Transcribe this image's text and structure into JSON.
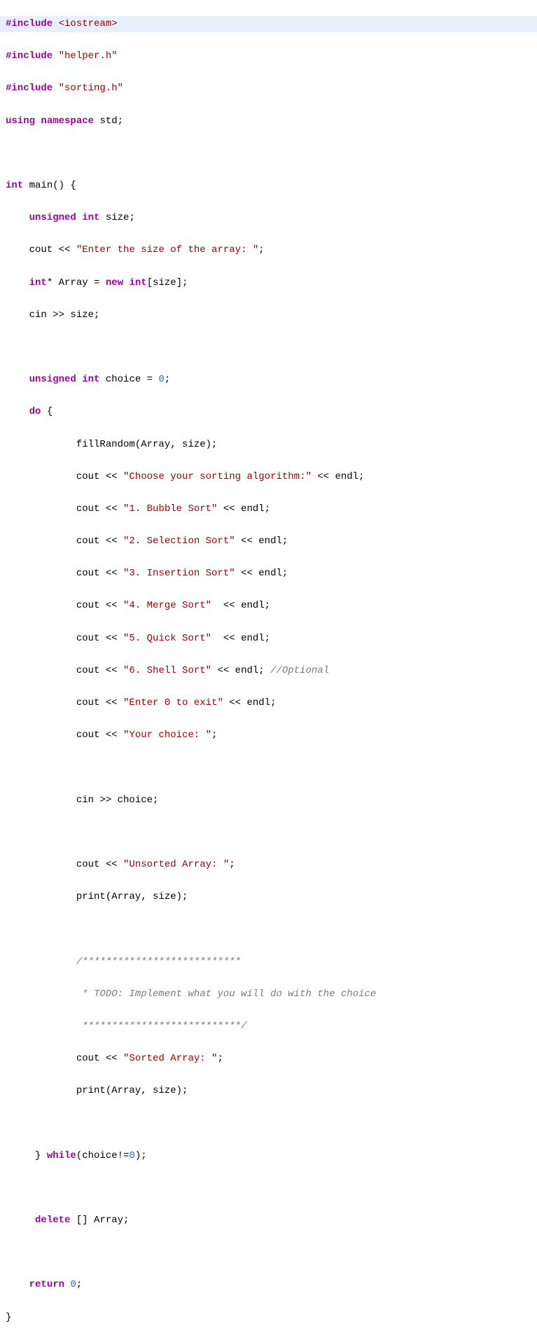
{
  "code": {
    "l1_dir": "#include ",
    "l1_inc": "<iostream>",
    "l2_dir": "#include ",
    "l2_inc": "\"helper.h\"",
    "l3_dir": "#include ",
    "l3_inc": "\"sorting.h\"",
    "l4_a": "using",
    "l4_b": "namespace",
    "l4_c": " std;",
    "l6_a": "int",
    "l6_b": " main() {",
    "l7_a": "    ",
    "l7_b": "unsigned",
    "l7_c": " ",
    "l7_d": "int",
    "l7_e": " size;",
    "l8_a": "    cout << ",
    "l8_b": "\"Enter the size of the array: \"",
    "l8_c": ";",
    "l9_a": "    ",
    "l9_b": "int",
    "l9_c": "* Array = ",
    "l9_d": "new",
    "l9_e": " ",
    "l9_f": "int",
    "l9_g": "[size];",
    "l10": "    cin >> size;",
    "l12_a": "    ",
    "l12_b": "unsigned",
    "l12_c": " ",
    "l12_d": "int",
    "l12_e": " choice = ",
    "l12_f": "0",
    "l12_g": ";",
    "l13_a": "    ",
    "l13_b": "do",
    "l13_c": " {",
    "l14": "            fillRandom(Array, size);",
    "l15_a": "            cout << ",
    "l15_b": "\"Choose your sorting algorithm:\"",
    "l15_c": " << endl;",
    "l16_a": "            cout << ",
    "l16_b": "\"1. Bubble Sort\"",
    "l16_c": " << endl;",
    "l17_a": "            cout << ",
    "l17_b": "\"2. Selection Sort\"",
    "l17_c": " << endl;",
    "l18_a": "            cout << ",
    "l18_b": "\"3. Insertion Sort\"",
    "l18_c": " << endl;",
    "l19_a": "            cout << ",
    "l19_b": "\"4. Merge Sort\"",
    "l19_c": "  << endl;",
    "l20_a": "            cout << ",
    "l20_b": "\"5. Quick Sort\"",
    "l20_c": "  << endl;",
    "l21_a": "            cout << ",
    "l21_b": "\"6. Shell Sort\"",
    "l21_c": " << endl; ",
    "l21_d": "//Optional",
    "l22_a": "            cout << ",
    "l22_b": "\"Enter 0 to exit\"",
    "l22_c": " << endl;",
    "l23_a": "            cout << ",
    "l23_b": "\"Your choice: \"",
    "l23_c": ";",
    "l25": "            cin >> choice;",
    "l27_a": "            cout << ",
    "l27_b": "\"Unsorted Array: \"",
    "l27_c": ";",
    "l28": "            print(Array, size);",
    "l30": "            /***************************",
    "l31": "             * TODO: Implement what you will do with the choice",
    "l32": "             ***************************/",
    "l33_a": "            cout << ",
    "l33_b": "\"Sorted Array: \"",
    "l33_c": ";",
    "l34": "            print(Array, size);",
    "l36_a": "     } ",
    "l36_b": "while",
    "l36_c": "(choice!=",
    "l36_d": "0",
    "l36_e": ");",
    "l38_a": "     ",
    "l38_b": "delete",
    "l38_c": " [] Array;",
    "l40_a": "    ",
    "l40_b": "return",
    "l40_c": " ",
    "l40_d": "0",
    "l40_e": ";",
    "l41": "}"
  }
}
